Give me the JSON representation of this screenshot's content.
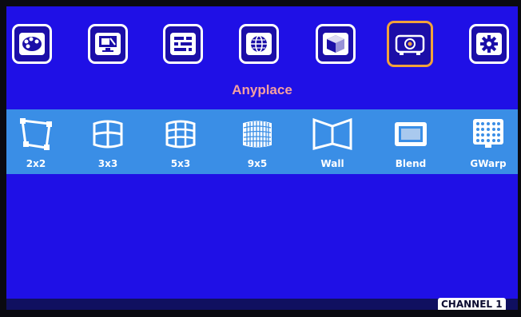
{
  "top_menu": {
    "items": [
      {
        "icon": "palette-icon"
      },
      {
        "icon": "monitor-settings-icon"
      },
      {
        "icon": "input-sliders-icon"
      },
      {
        "icon": "globe-icon"
      },
      {
        "icon": "3d-cube-icon"
      },
      {
        "icon": "projector-icon",
        "selected": true
      },
      {
        "icon": "gear-icon"
      }
    ],
    "selected_title": "Anyplace",
    "selected_color": "#f2a23a"
  },
  "sub_menu": {
    "items": [
      {
        "label": "2x2",
        "icon": "corner-points-icon"
      },
      {
        "label": "3x3",
        "icon": "curved-grid-3x3-icon"
      },
      {
        "label": "5x3",
        "icon": "curved-grid-5x3-icon"
      },
      {
        "label": "9x5",
        "icon": "curved-grid-9x5-icon"
      },
      {
        "label": "Wall",
        "icon": "corner-wall-icon"
      },
      {
        "label": "Blend",
        "icon": "edge-blend-icon"
      },
      {
        "label": "GWarp",
        "icon": "dot-grid-monitor-icon"
      }
    ]
  },
  "status": {
    "channel": "CHANNEL 1"
  },
  "colors": {
    "background": "#1f10e6",
    "band": "#3a8ee6",
    "title": "#f4a0a0"
  }
}
